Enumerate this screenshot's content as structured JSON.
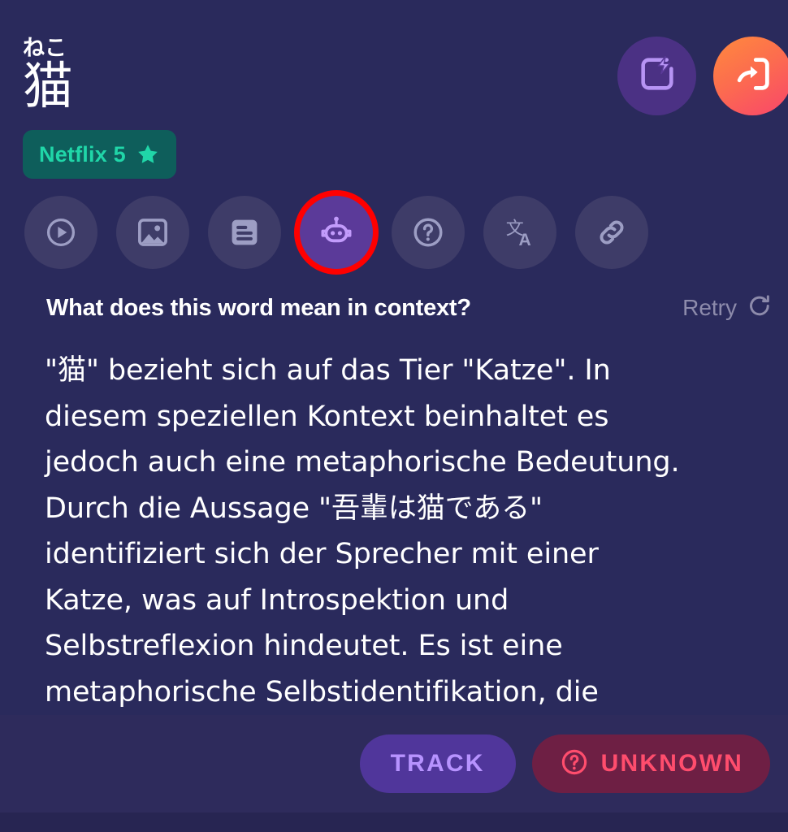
{
  "colors": {
    "app_bg": "#221f46",
    "content_bg": "#2a2a5c",
    "bottom_bar_bg": "#2e2b5c",
    "badge_bg": "#0e5e5b",
    "badge_text": "#20d6a8",
    "tool_bg": "#3e3c68",
    "tool_active_bg": "#5b3a99",
    "tool_active_ring": "#ff0000",
    "flash_btn_bg": "#4b3184",
    "enter_btn_gradient_from": "#ff8a3d",
    "enter_btn_gradient_to": "#f9456b",
    "track_bg": "#50369b",
    "track_text": "#b793ff",
    "unknown_bg": "#6e1f44",
    "unknown_text": "#ff4d6d",
    "retry_text": "#8d8bab",
    "body_text": "#ffffff"
  },
  "header": {
    "reading": "ねこ",
    "headword": "猫",
    "source_badge": {
      "label": "Netflix 5",
      "star_icon": "star-icon"
    },
    "actions": [
      {
        "name": "flashcard-button",
        "icon": "flash-card-icon"
      },
      {
        "name": "open-external-button",
        "icon": "enter-arrow-icon"
      }
    ]
  },
  "toolbar": {
    "items": [
      {
        "name": "tool-video",
        "icon": "play-circle-icon",
        "active": false
      },
      {
        "name": "tool-images",
        "icon": "image-icon",
        "active": false
      },
      {
        "name": "tool-text",
        "icon": "article-icon",
        "active": false
      },
      {
        "name": "tool-ai",
        "icon": "robot-icon",
        "active": true
      },
      {
        "name": "tool-quiz",
        "icon": "question-circle-icon",
        "active": false
      },
      {
        "name": "tool-translate",
        "icon": "translate-icon",
        "active": false
      },
      {
        "name": "tool-link",
        "icon": "link-icon",
        "active": false
      }
    ]
  },
  "answer_panel": {
    "question": "What does this word mean in context?",
    "retry_label": "Retry",
    "retry_icon": "refresh-icon",
    "body": "\"猫\" bezieht sich auf das Tier \"Katze\". In diesem speziellen Kontext beinhaltet es jedoch auch eine metaphorische Bedeutung. Durch die Aussage \"吾輩は猫である\" identifiziert sich der Sprecher mit einer Katze, was auf Introspektion und Selbstreflexion hindeutet. Es ist eine metaphorische Selbstidentifikation, die"
  },
  "bottom_bar": {
    "track_label": "TRACK",
    "unknown_label": "UNKNOWN",
    "unknown_icon": "question-circle-icon"
  }
}
